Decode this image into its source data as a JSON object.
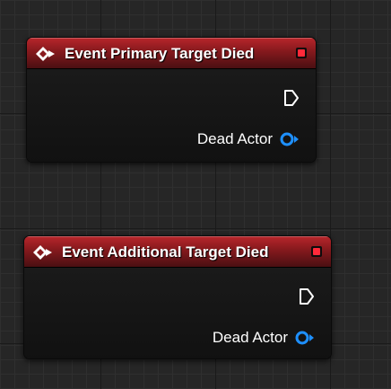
{
  "nodes": [
    {
      "title": "Event Primary Target Died",
      "icon": "event-diamond-icon",
      "pins": {
        "exec": "exec-out-pin",
        "output_label": "Dead Actor",
        "output_type": "object-reference"
      }
    },
    {
      "title": "Event Additional Target Died",
      "icon": "event-diamond-icon",
      "pins": {
        "exec": "exec-out-pin",
        "output_label": "Dead Actor",
        "output_type": "object-reference"
      }
    }
  ],
  "colors": {
    "header_red": "#b8262b",
    "delegate_pin": "#ff2a3a",
    "object_pin": "#1e90ff",
    "grid_background": "#262626"
  }
}
